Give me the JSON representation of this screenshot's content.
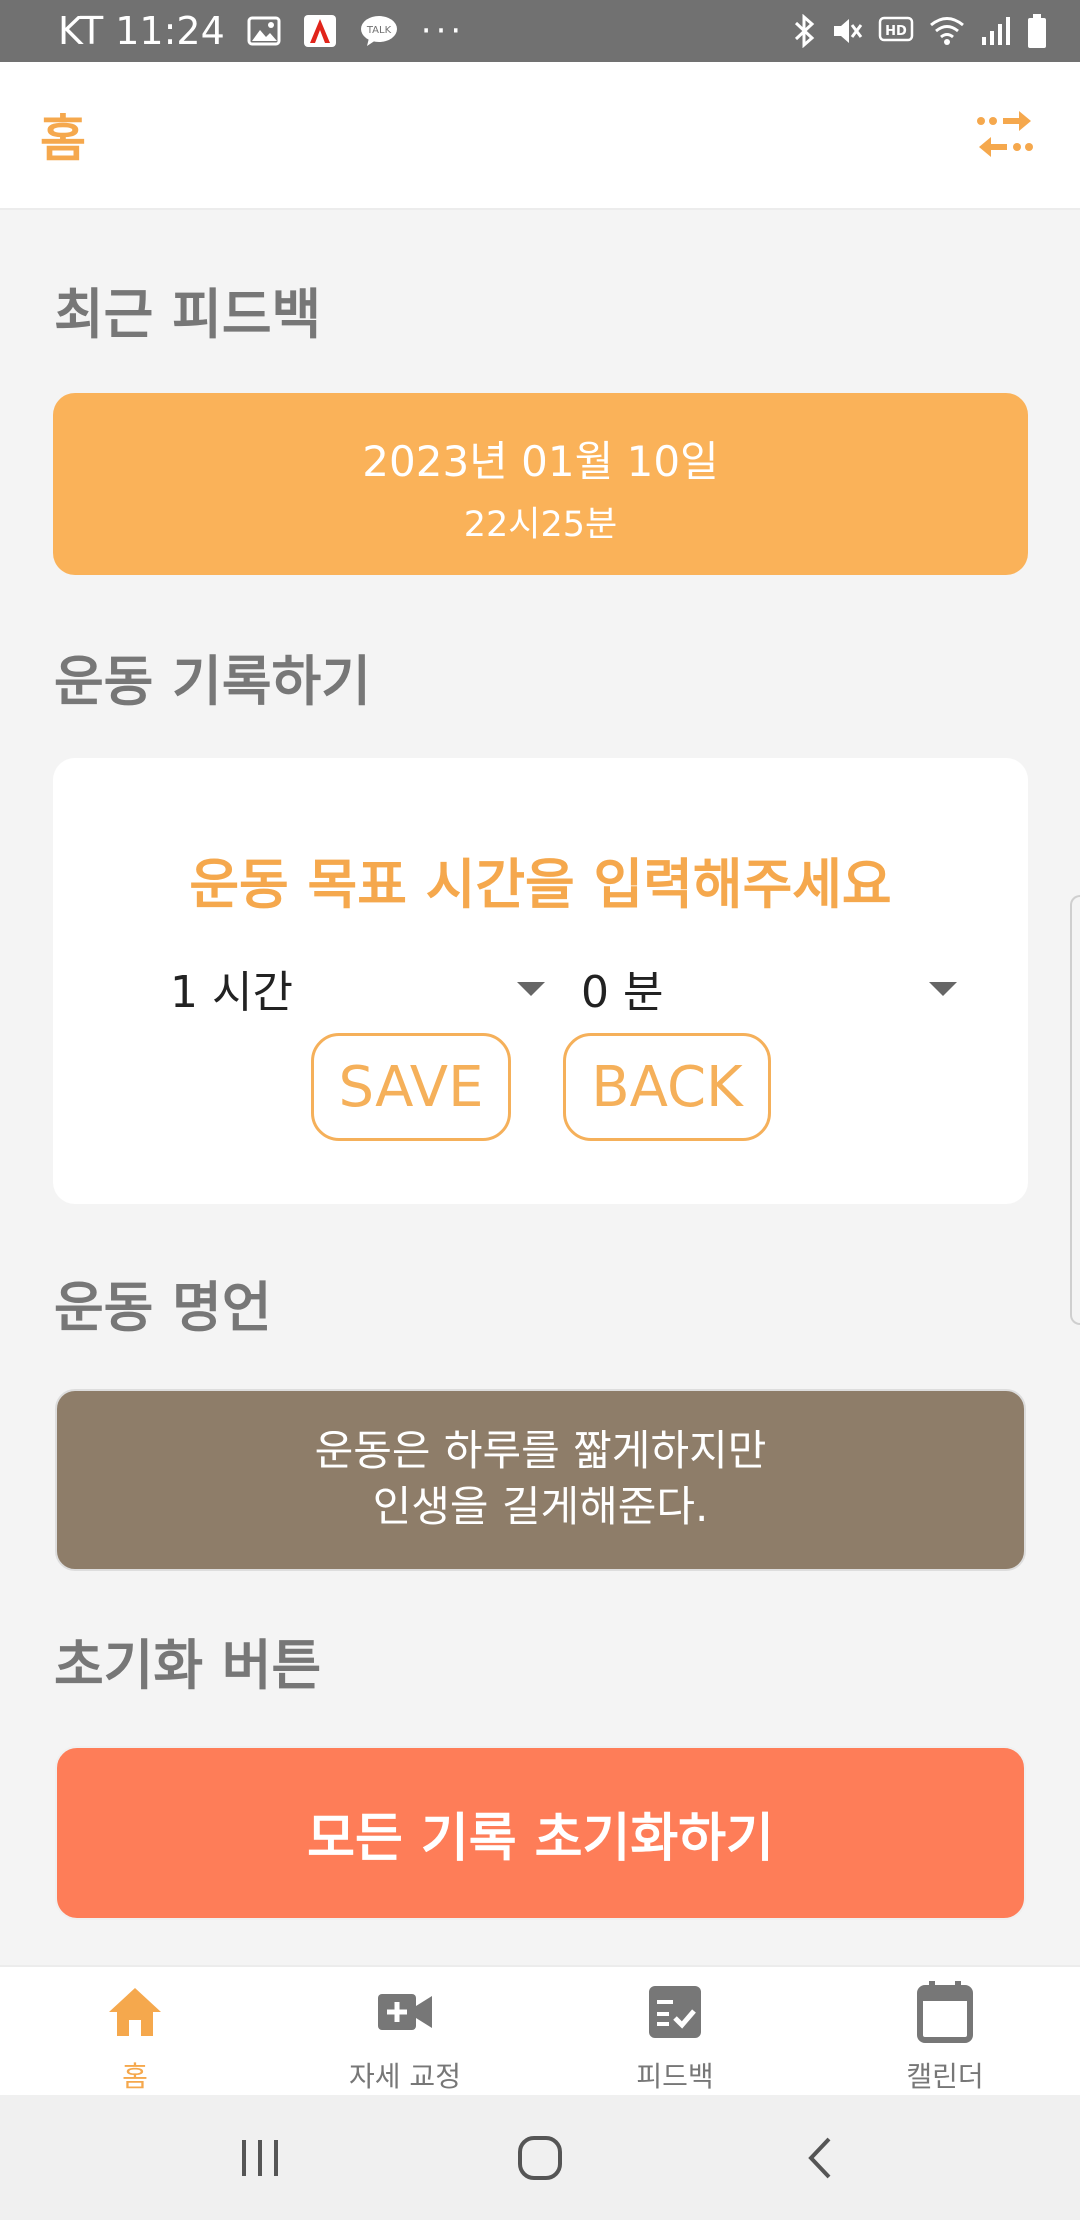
{
  "status_bar": {
    "carrier_time": "KT 11:24",
    "more": "···",
    "icons": [
      "gallery-icon",
      "acrobat-icon",
      "talk-icon",
      "bluetooth-icon",
      "mute-icon",
      "hd-icon",
      "wifi-icon",
      "signal-icon",
      "battery-icon"
    ],
    "talk_text": "TALK",
    "hd_text": "HD"
  },
  "app_bar": {
    "title": "홈",
    "swap_icon": "swap-arrows-icon"
  },
  "sections": {
    "recent_feedback": "최근 피드백",
    "exercise_record": "운동 기록하기",
    "exercise_quote": "운동 명언",
    "reset": "초기화 버튼"
  },
  "feedback": {
    "date": "2023년 01월 10일",
    "time": "22시25분"
  },
  "record": {
    "prompt": "운동 목표 시간을 입력해주세요",
    "hour_value": "1 시간",
    "minute_value": "0 분",
    "save_label": "SAVE",
    "back_label": "BACK"
  },
  "quote": {
    "line1": "운동은 하루를 짧게하지만",
    "line2": "인생을 길게해준다."
  },
  "reset_button": "모든 기록 초기화하기",
  "bottom_nav": {
    "home": "홈",
    "posture": "자세 교정",
    "feedback": "피드백",
    "calendar": "캘린더"
  },
  "colors": {
    "accent": "#f5a84d",
    "feedback_card": "#fab259",
    "quote_card": "#8e7d69",
    "reset_button": "#fe7d58",
    "status_bar": "#717171"
  }
}
